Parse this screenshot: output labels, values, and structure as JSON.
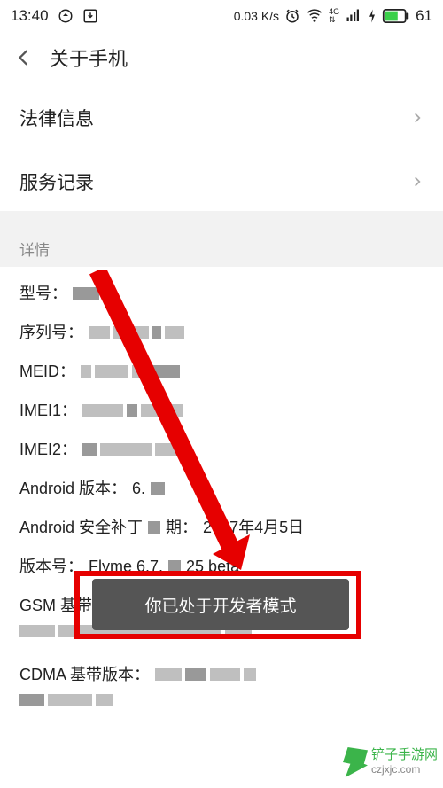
{
  "statusbar": {
    "time": "13:40",
    "speed": "0.03 K/s",
    "battery": "61"
  },
  "header": {
    "title": "关于手机"
  },
  "rows": {
    "legal": "法律信息",
    "service": "服务记录"
  },
  "section": {
    "details": "详情"
  },
  "details": {
    "model_label": "型号：",
    "serial_label": "序列号：",
    "meid_label": "MEID：",
    "imei1_label": "IMEI1：",
    "imei2_label": "IMEI2：",
    "android_ver_label": "Android 版本：",
    "android_ver_value": "6.",
    "patch_label": "Android 安全补丁",
    "patch_label2": "期：",
    "patch_value": "2017年4月5日",
    "build_label": "版本号：",
    "build_value": "Flyme 6.7.",
    "build_value2": "25 beta",
    "gsm_label": "GSM 基带版本",
    "cdma_label": "CDMA 基带版本："
  },
  "toast": {
    "message": "你已处于开发者模式"
  },
  "watermark": {
    "name": "铲子手游网",
    "url": "czjxjc.com"
  }
}
